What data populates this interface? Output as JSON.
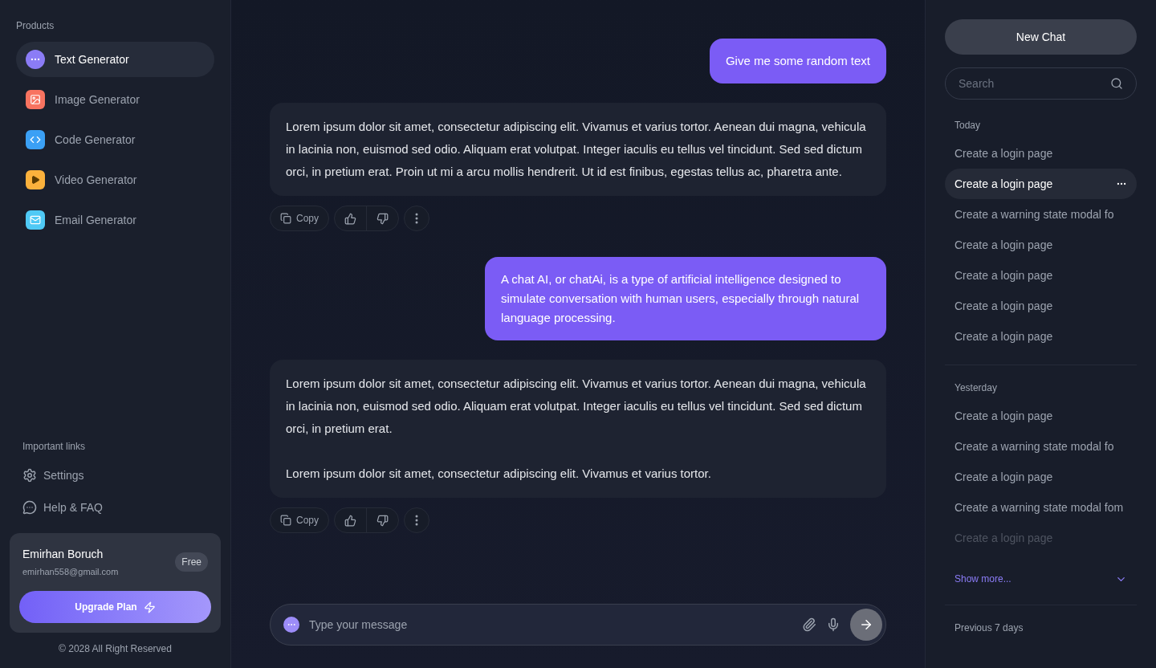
{
  "sidebar": {
    "products_heading": "Products",
    "products": [
      {
        "kind": "text",
        "label": "Text Generator",
        "selected": true
      },
      {
        "kind": "image",
        "label": "Image Generator",
        "selected": false
      },
      {
        "kind": "code",
        "label": "Code Generator",
        "selected": false
      },
      {
        "kind": "video",
        "label": "Video Generator",
        "selected": false
      },
      {
        "kind": "email",
        "label": "Email Generator",
        "selected": false
      }
    ],
    "links_heading": "Important links",
    "links": [
      {
        "kind": "settings",
        "label": "Settings"
      },
      {
        "kind": "help",
        "label": "Help & FAQ"
      }
    ],
    "user": {
      "name": "Emirhan Boruch",
      "email": "emirhan558@gmail.com",
      "plan": "Free",
      "upgrade": "Upgrade Plan"
    },
    "footer": "© 2028 All Right Reserved"
  },
  "messages": [
    {
      "kind": "user",
      "paragraphs": [
        "Give me some random text"
      ]
    },
    {
      "kind": "assistant",
      "paragraphs": [
        "Lorem ipsum dolor sit amet, consectetur adipiscing elit. Vivamus et varius tortor. Aenean dui magna, vehicula in lacinia non, euismod sed odio. Aliquam erat volutpat. Integer iaculis eu tellus vel tincidunt. Sed sed dictum orci, in pretium erat. Proin ut mi a arcu mollis hendrerit. Ut id est finibus, egestas tellus ac, pharetra ante."
      ],
      "copy": "Copy"
    },
    {
      "kind": "user",
      "paragraphs": [
        "A chat AI, or chatAi, is a type of artificial intelligence designed to simulate conversation with human users, especially through natural language processing."
      ]
    },
    {
      "kind": "assistant",
      "paragraphs": [
        "Lorem ipsum dolor sit amet, consectetur adipiscing elit. Vivamus et varius tortor. Aenean dui magna, vehicula in lacinia non, euismod sed odio. Aliquam erat volutpat. Integer iaculis eu tellus vel tincidunt. Sed sed dictum orci, in pretium erat.",
        "Lorem ipsum dolor sit amet, consectetur adipiscing elit. Vivamus et varius tortor."
      ],
      "copy": "Copy"
    }
  ],
  "composer": {
    "placeholder": "Type your message"
  },
  "history": {
    "new_chat": "New Chat",
    "search_placeholder": "Search",
    "groups": [
      {
        "title": "Today",
        "items": [
          {
            "label": "Create a login page",
            "selected": false,
            "faded": false
          },
          {
            "label": "Create a login page",
            "selected": true,
            "faded": false
          },
          {
            "label": "Create a warning state modal fo",
            "selected": false,
            "faded": false
          },
          {
            "label": "Create a login page",
            "selected": false,
            "faded": false
          },
          {
            "label": "Create a login page",
            "selected": false,
            "faded": false
          },
          {
            "label": "Create a login page",
            "selected": false,
            "faded": false
          },
          {
            "label": "Create a login page",
            "selected": false,
            "faded": false
          }
        ]
      },
      {
        "title": "Yesterday",
        "items": [
          {
            "label": "Create a login page",
            "selected": false,
            "faded": false
          },
          {
            "label": "Create a warning state modal fo",
            "selected": false,
            "faded": false
          },
          {
            "label": "Create a login page",
            "selected": false,
            "faded": false
          },
          {
            "label": "Create a warning state modal fom",
            "selected": false,
            "faded": false
          },
          {
            "label": "Create a login page",
            "selected": false,
            "faded": true
          }
        ],
        "show_more": "Show more..."
      },
      {
        "title": "Previous 7 days"
      }
    ]
  }
}
